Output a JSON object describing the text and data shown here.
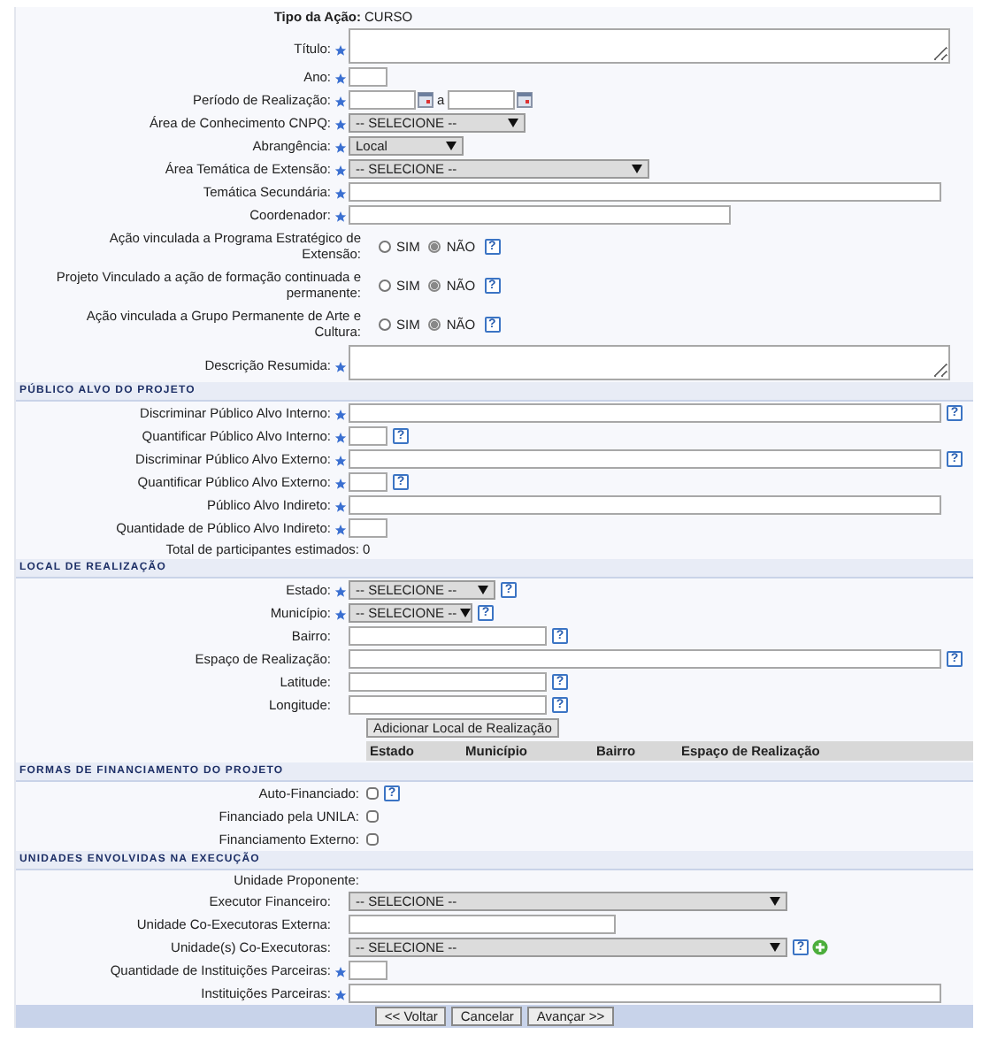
{
  "action_type": {
    "label": "Tipo da Ação:",
    "value": "CURSO"
  },
  "sections": [
    {
      "rows": [
        {
          "kind": "textarea",
          "label": "Título:",
          "required": true
        },
        {
          "kind": "input",
          "label": "Ano:",
          "required": true
        },
        {
          "kind": "date_range",
          "label": "Período de Realização:",
          "required": true,
          "separator": "a"
        },
        {
          "kind": "select",
          "label": "Área de Conhecimento CNPQ:",
          "required": true,
          "value": "-- SELECIONE --"
        },
        {
          "kind": "select",
          "label": "Abrangência:",
          "required": true,
          "value": "Local"
        },
        {
          "kind": "select",
          "label": "Área Temática de Extensão:",
          "required": true,
          "value": "-- SELECIONE --"
        },
        {
          "kind": "input",
          "label": "Temática Secundária:",
          "required": true
        },
        {
          "kind": "input",
          "label": "Coordenador:",
          "required": true
        },
        {
          "kind": "radio",
          "label": "Ação vinculada a Programa Estratégico de Extensão:",
          "options": [
            {
              "label": "SIM",
              "selected": false
            },
            {
              "label": "NÃO",
              "selected": true
            }
          ],
          "help": "?"
        },
        {
          "kind": "radio",
          "label": "Projeto Vinculado a ação de formação continuada e permanente:",
          "options": [
            {
              "label": "SIM",
              "selected": false
            },
            {
              "label": "NÃO",
              "selected": true
            }
          ],
          "help": "?"
        },
        {
          "kind": "radio",
          "label": "Ação vinculada a Grupo Permanente de Arte e Cultura:",
          "options": [
            {
              "label": "SIM",
              "selected": false
            },
            {
              "label": "NÃO",
              "selected": true
            }
          ],
          "help": "?"
        },
        {
          "kind": "textarea",
          "label": "Descrição Resumida:",
          "required": true
        }
      ]
    },
    {
      "title": "PÚBLICO ALVO DO PROJETO",
      "rows": [
        {
          "kind": "input",
          "label": "Discriminar Público Alvo Interno:",
          "required": true,
          "help": "?"
        },
        {
          "kind": "input",
          "label": "Quantificar Público Alvo Interno:",
          "required": true,
          "help": "?"
        },
        {
          "kind": "input",
          "label": "Discriminar Público Alvo Externo:",
          "required": true,
          "help": "?"
        },
        {
          "kind": "input",
          "label": "Quantificar Público Alvo Externo:",
          "required": true,
          "help": "?"
        },
        {
          "kind": "input",
          "label": "Público Alvo Indireto:",
          "required": true
        },
        {
          "kind": "input",
          "label": "Quantidade de Público Alvo Indireto:",
          "required": true
        },
        {
          "kind": "static",
          "label": "Total de participantes estimados:",
          "value": "0"
        }
      ]
    },
    {
      "title": "LOCAL DE REALIZAÇÃO",
      "rows": [
        {
          "kind": "select",
          "label": "Estado:",
          "required": true,
          "value": "-- SELECIONE --",
          "help": "?"
        },
        {
          "kind": "select",
          "label": "Município:",
          "required": true,
          "value": "-- SELECIONE --",
          "help": "?"
        },
        {
          "kind": "input",
          "label": "Bairro:",
          "required": false,
          "help": "?"
        },
        {
          "kind": "input",
          "label": "Espaço de Realização:",
          "required": false,
          "help": "?"
        },
        {
          "kind": "input",
          "label": "Latitude:",
          "required": false,
          "help": "?"
        },
        {
          "kind": "input",
          "label": "Longitude:",
          "required": false,
          "help": "?"
        },
        {
          "kind": "button",
          "label": "Adicionar Local de Realização"
        },
        {
          "kind": "table",
          "columns": [
            "Estado",
            "Município",
            "Bairro",
            "Espaço de Realização"
          ]
        }
      ]
    },
    {
      "title": "FORMAS DE FINANCIAMENTO DO PROJETO",
      "rows": [
        {
          "kind": "checkbox",
          "label": "Auto-Financiado:",
          "checked": false,
          "help": "?"
        },
        {
          "kind": "checkbox",
          "label": "Financiado pela UNILA:",
          "checked": false
        },
        {
          "kind": "checkbox",
          "label": "Financiamento Externo:",
          "checked": false
        }
      ]
    },
    {
      "title": "UNIDADES ENVOLVIDAS NA EXECUÇÃO",
      "rows": [
        {
          "kind": "static",
          "label": "Unidade Proponente:"
        },
        {
          "kind": "select",
          "label": "Executor Financeiro:",
          "required": false,
          "value": "-- SELECIONE --"
        },
        {
          "kind": "input",
          "label": "Unidade Co-Executoras Externa:",
          "required": false
        },
        {
          "kind": "select",
          "label": "Unidade(s) Co-Executoras:",
          "required": false,
          "value": "-- SELECIONE --",
          "help": "?",
          "add": true
        },
        {
          "kind": "input",
          "label": "Quantidade de Instituições Parceiras:",
          "required": true
        },
        {
          "kind": "input",
          "label": "Instituições Parceiras:",
          "required": true
        }
      ]
    }
  ],
  "buttons": [
    "<< Voltar",
    "Cancelar",
    "Avançar >>"
  ]
}
